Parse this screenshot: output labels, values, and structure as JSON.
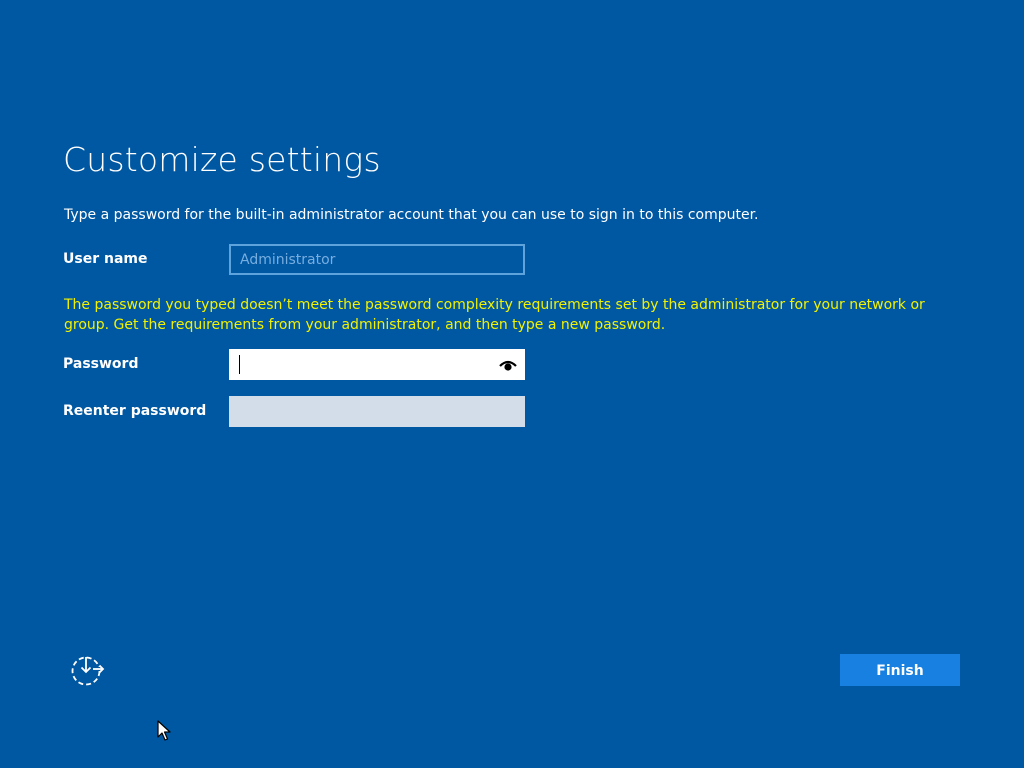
{
  "page": {
    "title": "Customize settings",
    "instruction": "Type a password for the built-in administrator account that you can use to sign in to this computer."
  },
  "form": {
    "username_label": "User name",
    "username_value": "Administrator",
    "error_message": "The password you typed doesn’t meet the password complexity requirements set by the administrator for your network or group. Get the requirements from your administrator, and then type a new password.",
    "password_label": "Password",
    "password_value": "",
    "reenter_label": "Reenter password",
    "reenter_value": ""
  },
  "footer": {
    "finish_label": "Finish"
  },
  "icons": {
    "password_reveal": "eye-icon",
    "ease_of_access": "ease-of-access-icon",
    "pointer": "mouse-cursor-icon"
  },
  "colors": {
    "background": "#0057a2",
    "error_text": "#f2f200",
    "button": "#1880e0"
  }
}
